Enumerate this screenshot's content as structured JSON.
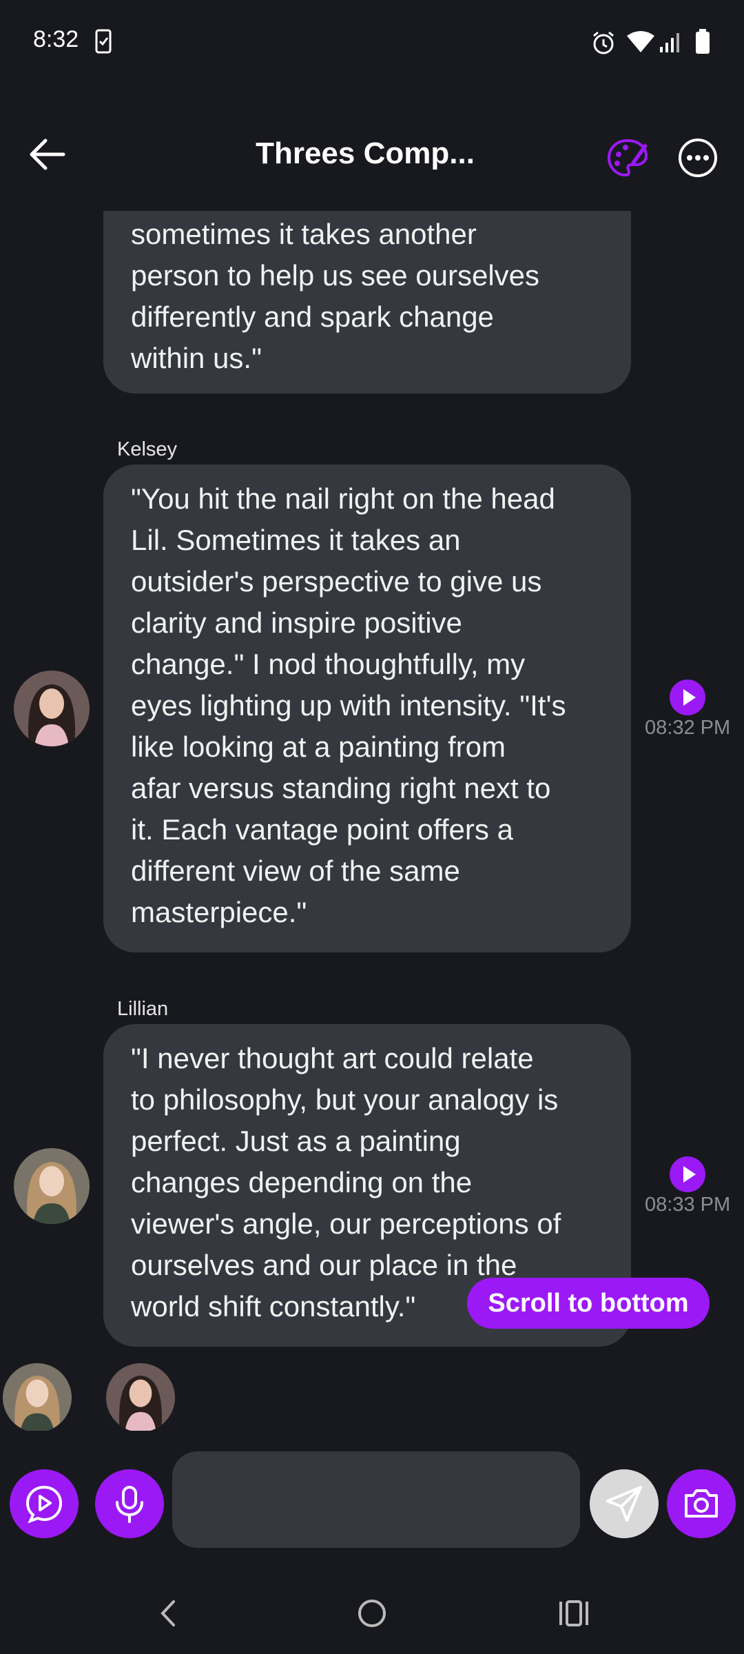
{
  "status_bar": {
    "time": "8:32"
  },
  "header": {
    "title": "Threes Comp...",
    "icons": [
      "back-arrow-icon",
      "palette-icon",
      "more-options-icon"
    ]
  },
  "messages": [
    {
      "sender": "",
      "lines": [
        "sometimes it takes another",
        "person to help us see ourselves",
        "differently and spark change",
        "within us.\""
      ]
    },
    {
      "sender": "Kelsey",
      "time": "08:32 PM",
      "lines": [
        "\"You hit the nail right on the head",
        "Lil. Sometimes it takes an",
        "outsider's perspective to give us",
        "clarity and inspire positive",
        "change.\" I nod thoughtfully, my",
        "eyes lighting up with intensity. \"It's",
        "like looking at a painting from",
        "afar versus standing right next to",
        "it. Each vantage point offers a",
        "different view of the same",
        "masterpiece.\""
      ]
    },
    {
      "sender": "Lillian",
      "time": "08:33 PM",
      "lines": [
        "\"I never thought art could relate",
        "to philosophy, but your analogy is",
        "perfect. Just as a painting",
        "changes depending on the",
        "viewer's angle, our perceptions of",
        "ourselves and our place in the",
        "world shift constantly.\""
      ]
    }
  ],
  "scroll_to_bottom_label": "Scroll to bottom",
  "input": {
    "placeholder": ""
  },
  "colors": {
    "background": "#18191e",
    "bubble": "#36383f",
    "accent": "#9b19f5",
    "send_button": "#d9d9d9"
  }
}
